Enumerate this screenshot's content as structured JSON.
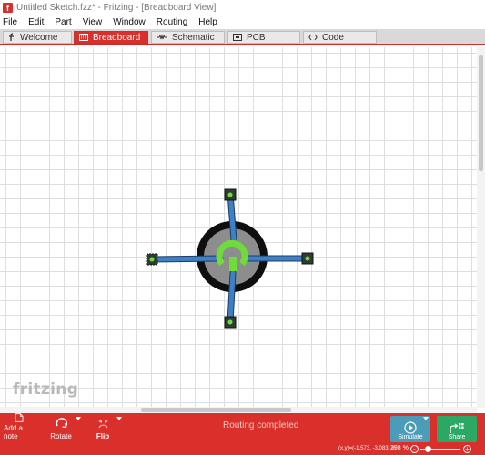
{
  "window": {
    "title": "Untitled Sketch.fzz* - Fritzing - [Breadboard View]",
    "app_icon_glyph": "f"
  },
  "menu": [
    "File",
    "Edit",
    "Part",
    "View",
    "Window",
    "Routing",
    "Help"
  ],
  "tabs": [
    {
      "label": "Welcome",
      "icon": "fritzing-f-icon",
      "active": false
    },
    {
      "label": "Breadboard",
      "icon": "breadboard-icon",
      "active": true
    },
    {
      "label": "Schematic",
      "icon": "resistor-symbol-icon",
      "active": false
    },
    {
      "label": "PCB",
      "icon": "pcb-icon",
      "active": false
    },
    {
      "label": "Code",
      "icon": "code-brackets-icon",
      "active": false
    }
  ],
  "canvas": {
    "logo_text": "fritzing",
    "part": "pushbutton-with-four-wired-legs"
  },
  "toolbar": {
    "add_note": "Add a note",
    "rotate": "Rotate",
    "flip": "Flip",
    "status_message": "Routing completed",
    "simulate": "Simulate",
    "share": "Share"
  },
  "statusbar": {
    "coordinates": "(x,y)=(-1.573, -3.083) in",
    "zoom": "298 %",
    "zoom_out": "-",
    "zoom_in": "+"
  },
  "colors": {
    "accent_red": "#d9302c",
    "simulate_blue": "#4a9cb8",
    "share_green": "#2aa864",
    "wire_blue": "#3f7fc4",
    "connector_green": "#6fdc3a"
  }
}
